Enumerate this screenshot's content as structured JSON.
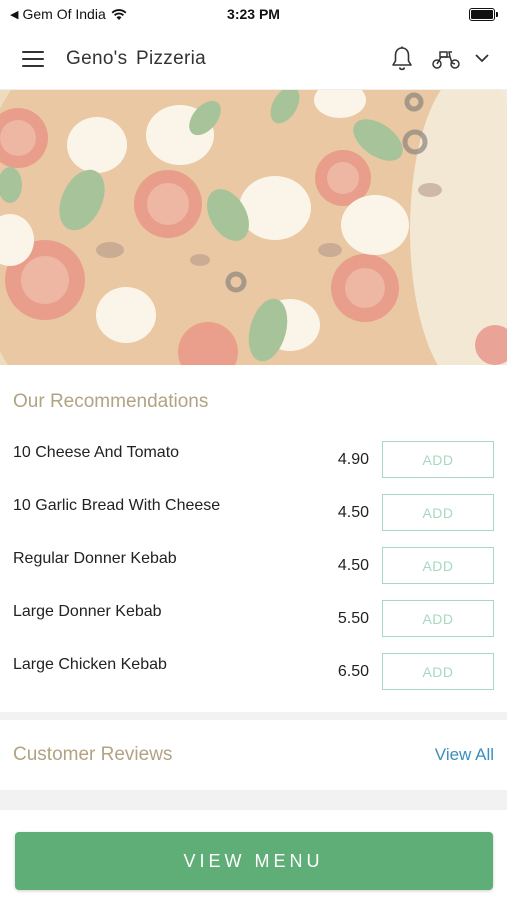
{
  "status_bar": {
    "carrier": "Gem Of India",
    "time": "3:23 PM"
  },
  "header": {
    "title": "Geno's  Pizzeria",
    "icons": [
      "menu-icon",
      "bell-icon",
      "scooter-icon",
      "chevron-down-icon"
    ]
  },
  "recommendations": {
    "title": "Our Recommendations",
    "items": [
      {
        "name": "10 Cheese And Tomato",
        "price": "4.90",
        "button": "ADD"
      },
      {
        "name": "10 Garlic Bread With Cheese",
        "price": "4.50",
        "button": "ADD"
      },
      {
        "name": "Regular Donner Kebab",
        "price": "4.50",
        "button": "ADD"
      },
      {
        "name": "Large Donner Kebab",
        "price": "5.50",
        "button": "ADD"
      },
      {
        "name": "Large Chicken Kebab",
        "price": "6.50",
        "button": "ADD"
      }
    ]
  },
  "reviews": {
    "title": "Customer Reviews",
    "view_all": "View All"
  },
  "footer": {
    "button": "VIEW MENU"
  },
  "colors": {
    "accent_green": "#5fae77",
    "section_title": "#b1a383",
    "link_blue": "#3a8fbd",
    "add_button": "#a8d8c0"
  }
}
